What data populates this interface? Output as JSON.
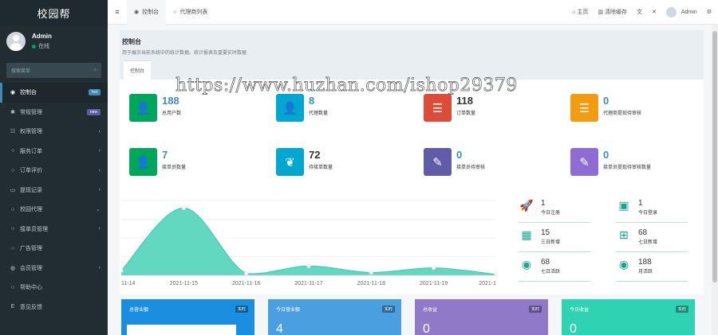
{
  "sidebar": {
    "brand": "校园帮",
    "user": {
      "name": "Admin",
      "status": "在线"
    },
    "search_placeholder": "搜索菜单",
    "items": [
      {
        "label": "控制台",
        "icon": "dashboard-icon",
        "badge": "hot",
        "badge_color": "#3c8dbc",
        "active": true
      },
      {
        "label": "常规管理",
        "icon": "cogs-icon",
        "badge": "new",
        "badge_color": "#605ca8"
      },
      {
        "label": "权限管理",
        "icon": "group-icon",
        "chevron": "‹"
      },
      {
        "label": "服务订单",
        "icon": "circle-icon",
        "chevron": "‹"
      },
      {
        "label": "订单评价",
        "icon": "circle-icon",
        "chevron": "‹"
      },
      {
        "label": "提现记录",
        "icon": "id-card-icon",
        "chevron": "‹"
      },
      {
        "label": "校园代理",
        "icon": "circle-icon",
        "chevron": "⌄"
      },
      {
        "label": "接单员管理",
        "icon": "circle-icon",
        "chevron": "‹"
      },
      {
        "label": "广告管理",
        "icon": "circle-icon"
      },
      {
        "label": "会员管理",
        "icon": "user-circle-icon",
        "chevron": "‹"
      },
      {
        "label": "帮助中心",
        "icon": "circle-icon"
      },
      {
        "label": "意见反馈",
        "icon": "e-icon"
      }
    ]
  },
  "topbar": {
    "tabs": [
      "控制台",
      "代理商列表"
    ],
    "home": "主页",
    "clear_cache": "清除缓存",
    "user": "Admin"
  },
  "page": {
    "title": "控制台",
    "description": "用于展示当前系统中的统计数据、统计报表及重要实时数据",
    "panel_tab": "控制台"
  },
  "stats": [
    {
      "value": "188",
      "label": "总用户数",
      "color": "#00a65a",
      "icon": "user-icon",
      "value_color": "#3c8dbc"
    },
    {
      "value": "8",
      "label": "代理数量",
      "color": "#00a7d0",
      "icon": "user-icon",
      "value_color": "#3c8dbc"
    },
    {
      "value": "118",
      "label": "订单数量",
      "color": "#dd4b39",
      "icon": "list-icon",
      "value_color": "#333"
    },
    {
      "value": "0",
      "label": "代理商提现待审核",
      "color": "#f39c12",
      "icon": "list-icon",
      "value_color": "#3c8dbc"
    },
    {
      "value": "7",
      "label": "接单员数量",
      "color": "#00a65a",
      "icon": "user-icon",
      "value_color": "#3c8dbc"
    },
    {
      "value": "72",
      "label": "待接单数量",
      "color": "#00a7d0",
      "icon": "leaf-icon",
      "value_color": "#333"
    },
    {
      "value": "0",
      "label": "接单员待审核",
      "color": "#605ca8",
      "icon": "magic-icon",
      "value_color": "#3c8dbc"
    },
    {
      "value": "0",
      "label": "接单员提现待审核数量",
      "color": "#8e6cd1",
      "icon": "magic-icon",
      "value_color": "#3c8dbc"
    }
  ],
  "mini_stats": [
    {
      "value": "1",
      "label": "今日注册",
      "icon": "rocket-icon"
    },
    {
      "value": "1",
      "label": "今日登录",
      "icon": "id-card-icon"
    },
    {
      "value": "15",
      "label": "三日新增",
      "icon": "calendar-icon"
    },
    {
      "value": "68",
      "label": "七日新增",
      "icon": "calendar-plus-icon"
    },
    {
      "value": "68",
      "label": "七日活跃",
      "icon": "user-circle-icon"
    },
    {
      "value": "188",
      "label": "月活跃",
      "icon": "user-circle-icon"
    }
  ],
  "chart_data": {
    "type": "area",
    "categories": [
      "11-14",
      "2021-11-15",
      "2021-11-16",
      "2021-11-17",
      "2021-11-18",
      "2021-11-19",
      "2021-1"
    ],
    "series": [
      {
        "values": [
          5,
          72,
          2,
          10,
          3,
          8,
          1
        ]
      }
    ],
    "ylim": [
      0,
      80
    ],
    "grid": true,
    "color": "#5ad6be"
  },
  "cards": [
    {
      "title": "总营业额",
      "tag": "实时",
      "value": "",
      "color": "#1b8ee0"
    },
    {
      "title": "今日营业额",
      "tag": "实时",
      "value": "4",
      "color": "#4a9fe0"
    },
    {
      "title": "总收益",
      "tag": "实时",
      "value": "0",
      "color": "#8e7ac6"
    },
    {
      "title": "今日收益",
      "tag": "实时",
      "value": "0",
      "color": "#2fd3b3"
    }
  ],
  "watermark": "https://www.huzhan.com/ishop29379"
}
